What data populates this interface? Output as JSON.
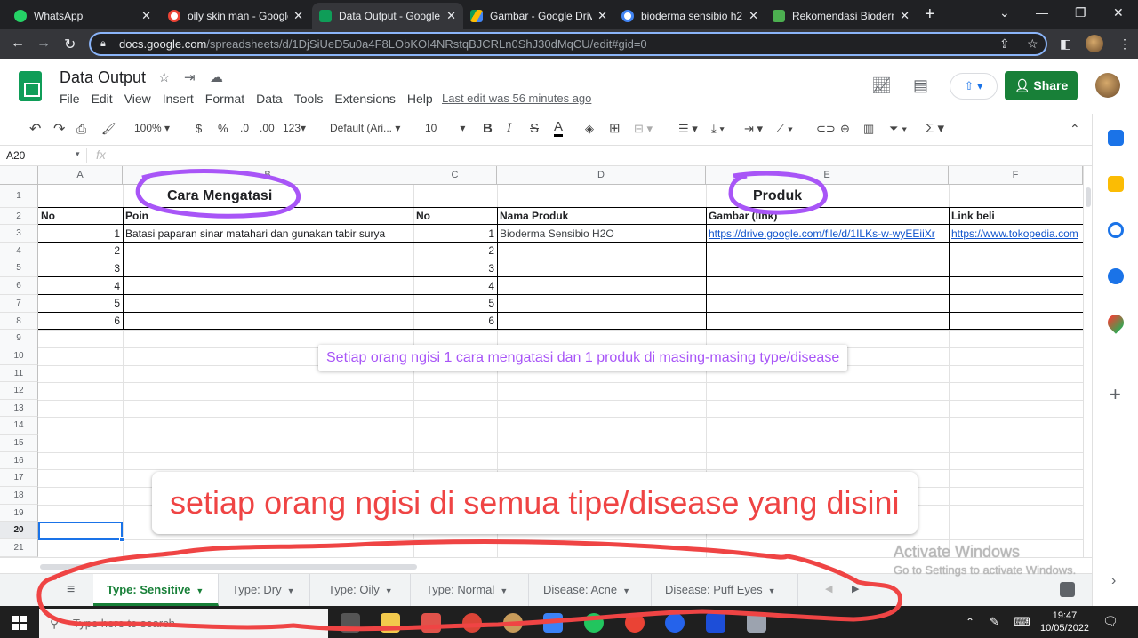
{
  "browser": {
    "tabs": [
      {
        "title": "WhatsApp",
        "favicon_color": "#25d366"
      },
      {
        "title": "oily skin man - Google",
        "favicon_color": "#ffffff"
      },
      {
        "title": "Data Output - Google",
        "favicon_color": "#0f9d58"
      },
      {
        "title": "Gambar - Google Driv",
        "favicon_color": "#fbbc04"
      },
      {
        "title": "bioderma sensibio h2",
        "favicon_color": "#ffffff"
      },
      {
        "title": "Rekomendasi Bioderm",
        "favicon_color": "#4caf50"
      }
    ],
    "url_host": "docs.google.com",
    "url_path": "/spreadsheets/d/1DjSiUeD5u0a4F8LObKOI4NRstqBJCRLn0ShJ30dMqCU/edit#gid=0"
  },
  "app": {
    "title": "Data Output",
    "menus": [
      "File",
      "Edit",
      "View",
      "Insert",
      "Format",
      "Data",
      "Tools",
      "Extensions",
      "Help"
    ],
    "last_edit": "Last edit was 56 minutes ago",
    "share_label": "Share"
  },
  "toolbar": {
    "zoom": "100%",
    "currency": "$",
    "percent": "%",
    "dec_less": ".0",
    "dec_more": ".00",
    "format_more": "123",
    "font": "Default (Ari...",
    "font_size": "10",
    "bold": "B",
    "italic": "I",
    "strike": "S",
    "text_color": "A"
  },
  "formula_bar": {
    "name_box": "A20",
    "fx": "fx"
  },
  "grid": {
    "columns": [
      "A",
      "B",
      "C",
      "D",
      "E",
      "F"
    ],
    "rows": [
      "1",
      "2",
      "3",
      "4",
      "5",
      "6",
      "7",
      "8",
      "9",
      "10",
      "11",
      "12",
      "13",
      "14",
      "15",
      "16",
      "17",
      "18",
      "19",
      "20",
      "21"
    ],
    "headers": {
      "section1": "Cara Mengatasi",
      "section2": "Produk",
      "no1": "No",
      "poin": "Poin",
      "no2": "No",
      "nama_produk": "Nama Produk",
      "gambar": "Gambar (link)",
      "link_beli": "Link beli"
    },
    "nums1": [
      "1",
      "2",
      "3",
      "4",
      "5",
      "6"
    ],
    "nums2": [
      "1",
      "2",
      "3",
      "4",
      "5",
      "6"
    ],
    "poin1": "Batasi paparan sinar matahari dan gunakan tabir surya",
    "produk1": "Bioderma Sensibio H2O",
    "gambar1": "https://drive.google.com/file/d/1ILKs-w-wyEEiiXr",
    "link1": "https://www.tokopedia.com"
  },
  "notes": {
    "note1": "Setiap orang ngisi 1 cara mengatasi dan 1 produk di masing-masing type/disease",
    "note2": "setiap orang ngisi di semua tipe/disease yang disini"
  },
  "sheets": [
    {
      "label": "Type: Sensitive",
      "active": true
    },
    {
      "label": "Type: Dry",
      "active": false
    },
    {
      "label": "Type: Oily",
      "active": false
    },
    {
      "label": "Type: Normal",
      "active": false
    },
    {
      "label": "Disease: Acne",
      "active": false
    },
    {
      "label": "Disease: Puff Eyes",
      "active": false
    }
  ],
  "watermark": {
    "line1": "Activate Windows",
    "line2": "Go to Settings to activate Windows."
  },
  "taskbar": {
    "search_placeholder": "Type here to search",
    "time": "19:47",
    "date": "10/05/2022"
  },
  "colors": {
    "sheets_green": "#188038",
    "annotation_purple": "#a855f7",
    "annotation_red": "#ef4444",
    "link_blue": "#1155cc"
  }
}
